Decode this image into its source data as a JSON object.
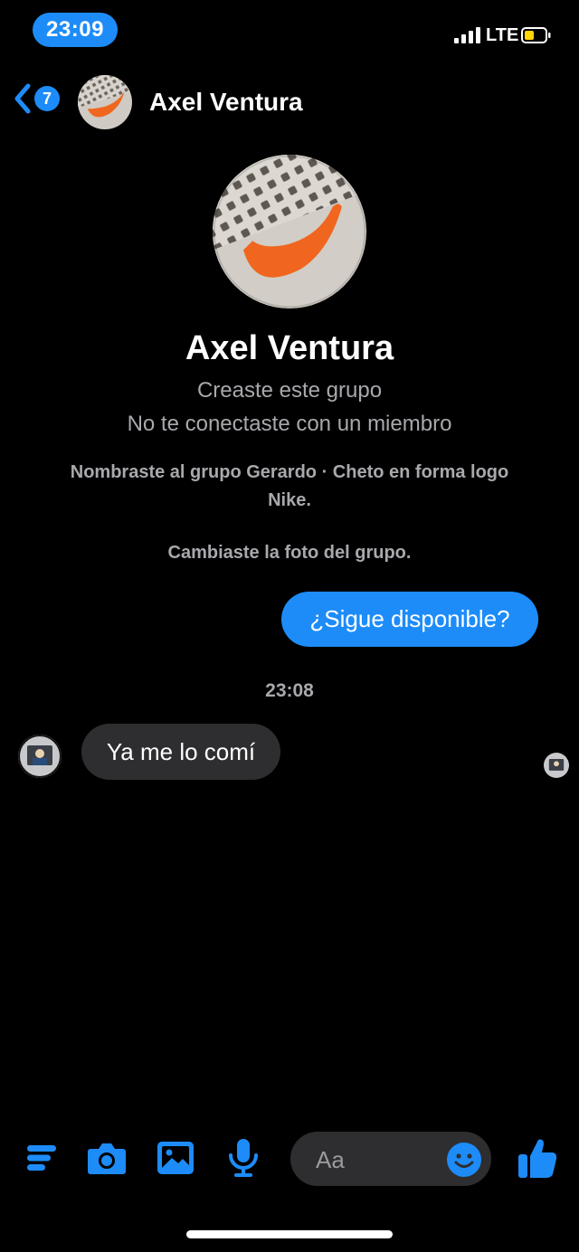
{
  "status_bar": {
    "time": "23:09",
    "network": "LTE"
  },
  "header": {
    "back_badge_count": "7",
    "title": "Axel Ventura"
  },
  "profile": {
    "name": "Axel Ventura",
    "line1": "Creaste este grupo",
    "line2": "No te conectaste con un miembro"
  },
  "events": {
    "renamed": "Nombraste al grupo Gerardo · Cheto en forma logo Nike.",
    "photo_changed": "Cambiaste la foto del grupo."
  },
  "messages": {
    "outgoing_1": "¿Sigue disponible?",
    "timestamp": "23:08",
    "incoming_1": "Ya me lo comí"
  },
  "composer": {
    "placeholder": "Aa"
  },
  "colors": {
    "accent": "#1d8cf8",
    "incoming_bubble": "#2e2e30",
    "background": "#000000"
  },
  "icons": [
    "signal-icon",
    "battery-icon",
    "back-chevron-icon",
    "menu-icon",
    "camera-icon",
    "image-icon",
    "microphone-icon",
    "emoji-icon",
    "thumbs-up-icon"
  ]
}
